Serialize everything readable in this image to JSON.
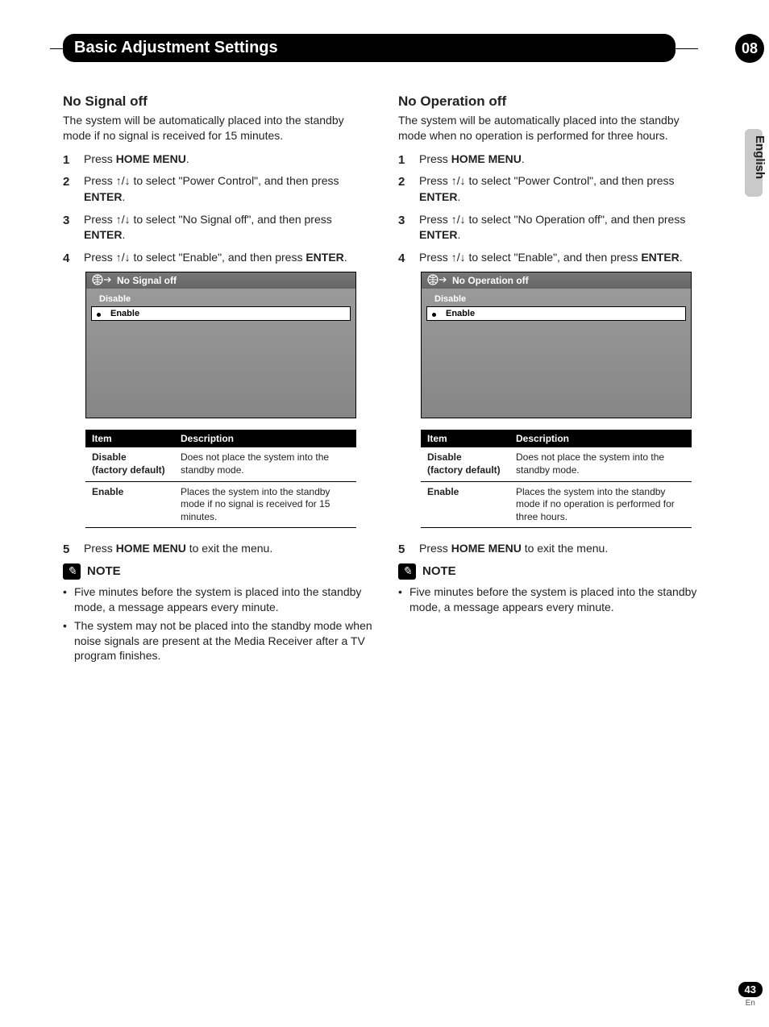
{
  "header": {
    "title": "Basic Adjustment Settings",
    "chapter": "08"
  },
  "sidebar": {
    "language": "English"
  },
  "footer": {
    "page": "43",
    "lang_short": "En"
  },
  "common": {
    "press": "Press ",
    "home_menu": "HOME MENU",
    "enter": "ENTER",
    "arrows_sel_pre": "Press ",
    "to_select": " to select ",
    "and_then_press": ", and then press ",
    "note_label": "NOTE",
    "exit_menu": " to exit the menu.",
    "item_h": "Item",
    "desc_h": "Description"
  },
  "left": {
    "heading": "No Signal off",
    "intro": "The system will be automatically placed into the standby mode if no signal is received for 15 minutes.",
    "step2_target": "\"Power Control\"",
    "step3_target": "\"No Signal off\"",
    "step4_target": "\"Enable\"",
    "osd_title": "No Signal off",
    "osd_disable": "Disable",
    "osd_enable": "Enable",
    "tbl": {
      "disable_item": "Disable",
      "disable_sub": "(factory default)",
      "disable_desc": "Does not place the system into the standby mode.",
      "enable_item": "Enable",
      "enable_desc": "Places the system into the standby mode if no signal is received for 15 minutes."
    },
    "notes": [
      "Five minutes before the system is placed into the standby mode, a message appears every minute.",
      "The system may not be placed into the standby mode when noise signals are present at the Media Receiver after a TV program finishes."
    ]
  },
  "right": {
    "heading": "No Operation off",
    "intro": "The system will be automatically placed into the standby mode when no operation is performed for three hours.",
    "step2_target": "\"Power Control\"",
    "step3_target": "\"No Operation off\"",
    "step4_target": "\"Enable\"",
    "osd_title": "No Operation off",
    "osd_disable": "Disable",
    "osd_enable": "Enable",
    "tbl": {
      "disable_item": "Disable",
      "disable_sub": "(factory default)",
      "disable_desc": "Does not place the system into the standby mode.",
      "enable_item": "Enable",
      "enable_desc": "Places the system into the standby mode if no operation is performed for three hours."
    },
    "notes": [
      "Five minutes before the system is placed into the standby mode, a message appears every minute."
    ]
  }
}
